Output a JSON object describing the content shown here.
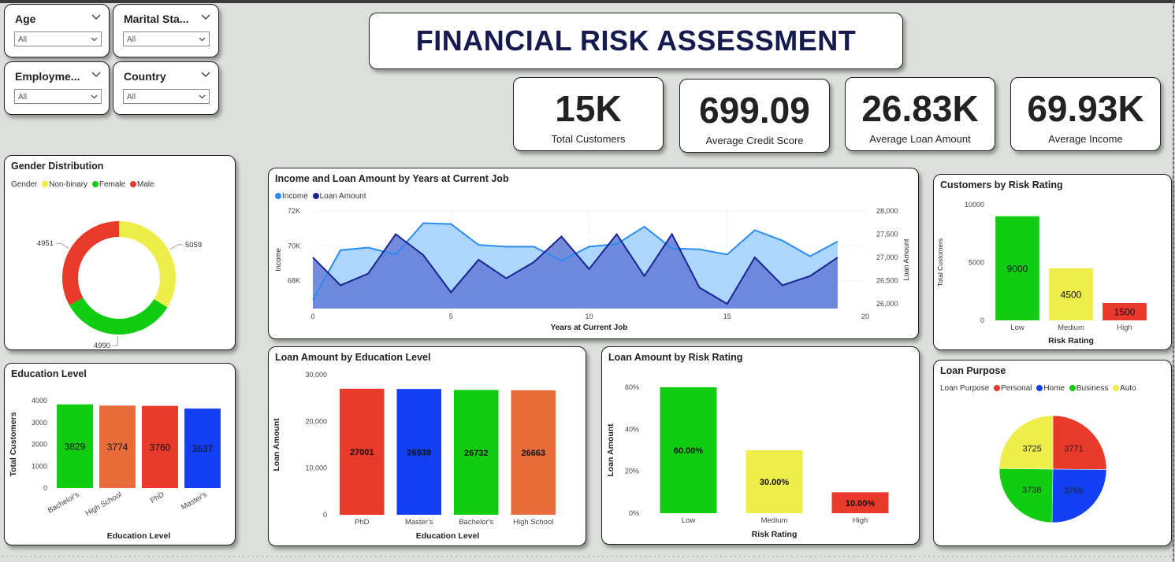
{
  "title": "FINANCIAL RISK ASSESSMENT",
  "slicers": [
    {
      "label": "Age",
      "value": "All"
    },
    {
      "label": "Marital Sta...",
      "value": "All"
    },
    {
      "label": "Employme...",
      "value": "All"
    },
    {
      "label": "Country",
      "value": "All"
    }
  ],
  "kpis": [
    {
      "value": "15K",
      "label": "Total Customers"
    },
    {
      "value": "699.09",
      "label": "Average Credit Score"
    },
    {
      "value": "26.83K",
      "label": "Average Loan Amount"
    },
    {
      "value": "69.93K",
      "label": "Average Income"
    }
  ],
  "colors": {
    "green": "#12cc12",
    "yellow": "#eeee4a",
    "red": "#e8392a",
    "orange": "#e86b3a",
    "blue": "#1440f5",
    "income_fill": "#a8d4fb",
    "income_line": "#2a8cef",
    "loan_fill": "#6680d8",
    "loan_line": "#1a2490",
    "navy": "#151b4e"
  },
  "chart_data": [
    {
      "id": "gender",
      "type": "pie",
      "donut": true,
      "title": "Gender Distribution",
      "legend_title": "Gender",
      "categories": [
        "Non-binary",
        "Female",
        "Male"
      ],
      "values": [
        5059,
        4990,
        4951
      ],
      "colors": [
        "#eeee4a",
        "#12cc12",
        "#e8392a"
      ]
    },
    {
      "id": "income_loan",
      "type": "area",
      "title": "Income and Loan Amount by Years at Current Job",
      "xlabel": "Years at Current Job",
      "ylabel": "Income",
      "y2label": "Loan Amount",
      "xlim": [
        0,
        20
      ],
      "xticks": [
        "0",
        "5",
        "10",
        "15",
        "20"
      ],
      "ylim": [
        66400,
        72000
      ],
      "yticks": [
        {
          "v": 68000,
          "l": "68K"
        },
        {
          "v": 70000,
          "l": "70K"
        },
        {
          "v": 72000,
          "l": "72K"
        }
      ],
      "y2lim": [
        25900,
        28000
      ],
      "y2ticks": [
        {
          "v": 26000,
          "l": "26,000"
        },
        {
          "v": 26500,
          "l": "26,500"
        },
        {
          "v": 27000,
          "l": "27,000"
        },
        {
          "v": 27500,
          "l": "27,500"
        },
        {
          "v": 28000,
          "l": "28,000"
        }
      ],
      "x": [
        0,
        1,
        2,
        3,
        4,
        5,
        6,
        7,
        8,
        9,
        10,
        11,
        12,
        13,
        14,
        15,
        16,
        17,
        18,
        19
      ],
      "series": [
        {
          "name": "Income",
          "axis": "left",
          "values": [
            66900,
            69750,
            69900,
            69500,
            71300,
            71250,
            70050,
            69950,
            69950,
            69150,
            69950,
            70100,
            71100,
            69850,
            69800,
            69500,
            70900,
            70300,
            69400,
            70250
          ]
        },
        {
          "name": "Loan Amount",
          "axis": "right",
          "values": [
            27000,
            26400,
            26650,
            27500,
            27050,
            26250,
            26950,
            26550,
            26900,
            27450,
            26750,
            27500,
            26600,
            27500,
            26350,
            26000,
            27000,
            26400,
            26600,
            27000
          ]
        }
      ]
    },
    {
      "id": "risk_customers",
      "type": "bar",
      "title": "Customers by Risk Rating",
      "xlabel": "Risk Rating",
      "ylabel": "Total Customers",
      "ylim": [
        0,
        10000
      ],
      "yticks": [
        0,
        5000,
        10000
      ],
      "categories": [
        "Low",
        "Medium",
        "High"
      ],
      "values": [
        9000,
        4500,
        1500
      ],
      "labels": [
        "9000",
        "4500",
        "1500"
      ],
      "colors": [
        "#12cc12",
        "#eeee4a",
        "#e8392a"
      ]
    },
    {
      "id": "education_customers",
      "type": "bar",
      "title": "Education Level",
      "xlabel": "Education Level",
      "ylabel": "Total Customers",
      "ylim": [
        0,
        4000
      ],
      "yticks": [
        0,
        1000,
        2000,
        3000,
        4000
      ],
      "categories": [
        "Bachelor's",
        "High School",
        "PhD",
        "Master's"
      ],
      "values": [
        3829,
        3774,
        3760,
        3637
      ],
      "labels": [
        "3829",
        "3774",
        "3760",
        "3637"
      ],
      "colors": [
        "#12cc12",
        "#e86b3a",
        "#e8392a",
        "#1440f5"
      ]
    },
    {
      "id": "education_loan",
      "type": "bar",
      "title": "Loan Amount by Education Level",
      "xlabel": "Education Level",
      "ylabel": "Loan Amount",
      "ylim": [
        0,
        30000
      ],
      "yticks": [
        {
          "v": 0,
          "l": "0"
        },
        {
          "v": 10000,
          "l": "10,000"
        },
        {
          "v": 20000,
          "l": "20,000"
        },
        {
          "v": 30000,
          "l": "30,000"
        }
      ],
      "categories": [
        "PhD",
        "Master's",
        "Bachelor's",
        "High School"
      ],
      "values": [
        27001,
        26939,
        26732,
        26663
      ],
      "labels": [
        "27001",
        "26939",
        "26732",
        "26663"
      ],
      "colors": [
        "#e8392a",
        "#1440f5",
        "#12cc12",
        "#e86b3a"
      ]
    },
    {
      "id": "risk_loan",
      "type": "bar",
      "title": "Loan Amount by Risk Rating",
      "xlabel": "Risk Rating",
      "ylabel": "Loan Amount",
      "ylim": [
        0,
        60
      ],
      "yticks": [
        {
          "v": 0,
          "l": "0%"
        },
        {
          "v": 20,
          "l": "20%"
        },
        {
          "v": 40,
          "l": "40%"
        },
        {
          "v": 60,
          "l": "60%"
        }
      ],
      "categories": [
        "Low",
        "Medium",
        "High"
      ],
      "values": [
        60,
        30,
        10
      ],
      "labels": [
        "60.00%",
        "30.00%",
        "10.00%"
      ],
      "colors": [
        "#12cc12",
        "#eeee4a",
        "#e8392a"
      ]
    },
    {
      "id": "loan_purpose",
      "type": "pie",
      "title": "Loan Purpose",
      "legend_title": "Loan Purpose",
      "categories": [
        "Personal",
        "Home",
        "Business",
        "Auto"
      ],
      "values": [
        3771,
        3766,
        3738,
        3725
      ],
      "colors": [
        "#e8392a",
        "#1440f5",
        "#12cc12",
        "#eeee4a"
      ]
    }
  ]
}
